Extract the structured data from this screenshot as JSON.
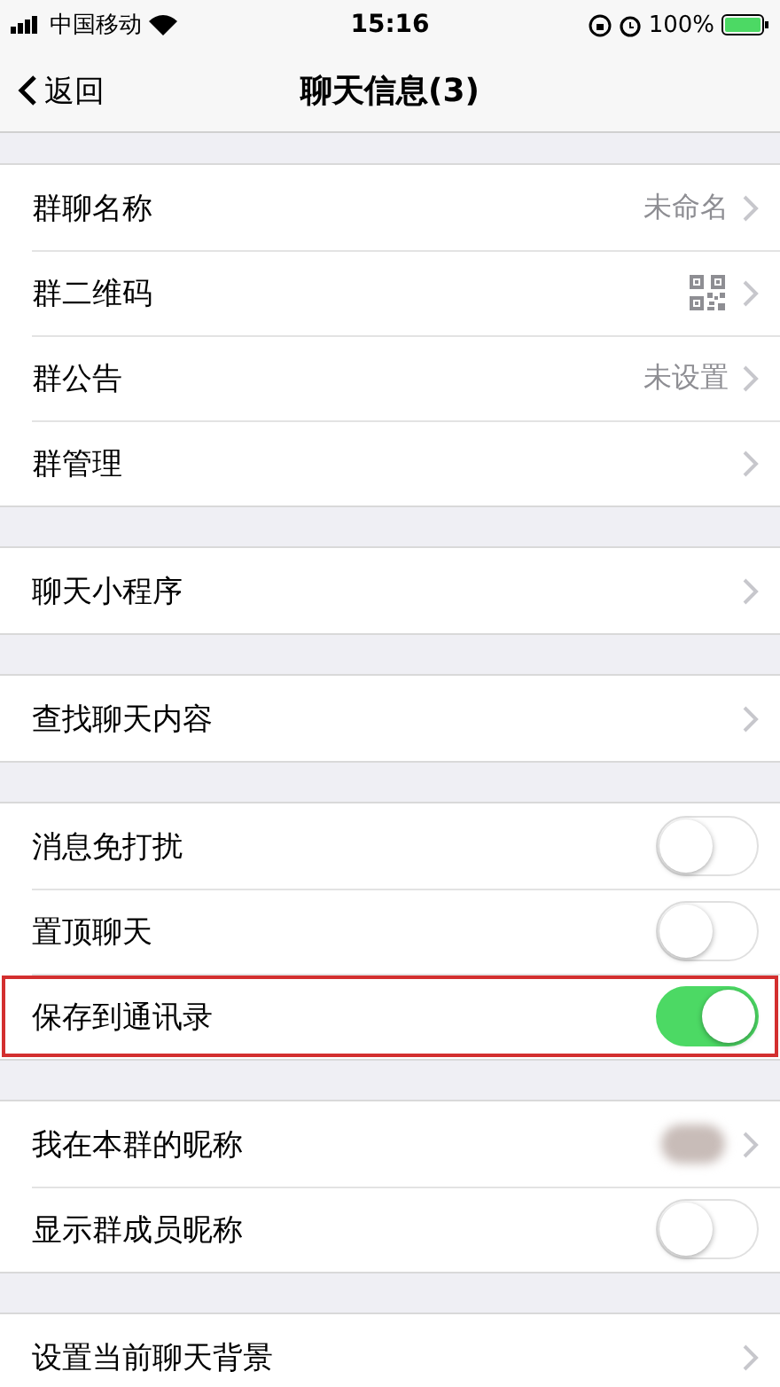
{
  "status_bar": {
    "carrier": "中国移动",
    "time": "15:16",
    "battery": "100%"
  },
  "nav": {
    "back": "返回",
    "title": "聊天信息(3)"
  },
  "sections": [
    {
      "rows": [
        {
          "kind": "value",
          "label": "群聊名称",
          "value": "未命名",
          "highlighted": false
        },
        {
          "kind": "qr",
          "label": "群二维码",
          "highlighted": false
        },
        {
          "kind": "value",
          "label": "群公告",
          "value": "未设置",
          "highlighted": false
        },
        {
          "kind": "link",
          "label": "群管理",
          "highlighted": false
        }
      ]
    },
    {
      "rows": [
        {
          "kind": "link",
          "label": "聊天小程序",
          "highlighted": false
        }
      ]
    },
    {
      "rows": [
        {
          "kind": "link",
          "label": "查找聊天内容",
          "highlighted": false
        }
      ]
    },
    {
      "rows": [
        {
          "kind": "toggle",
          "label": "消息免打扰",
          "on": false,
          "highlighted": false
        },
        {
          "kind": "toggle",
          "label": "置顶聊天",
          "on": false,
          "highlighted": false
        },
        {
          "kind": "toggle",
          "label": "保存到通讯录",
          "on": true,
          "highlighted": true
        }
      ]
    },
    {
      "rows": [
        {
          "kind": "blurred",
          "label": "我在本群的昵称",
          "highlighted": false
        },
        {
          "kind": "toggle",
          "label": "显示群成员昵称",
          "on": false,
          "highlighted": false
        }
      ]
    },
    {
      "rows": [
        {
          "kind": "link",
          "label": "设置当前聊天背景",
          "highlighted": false
        }
      ]
    }
  ]
}
